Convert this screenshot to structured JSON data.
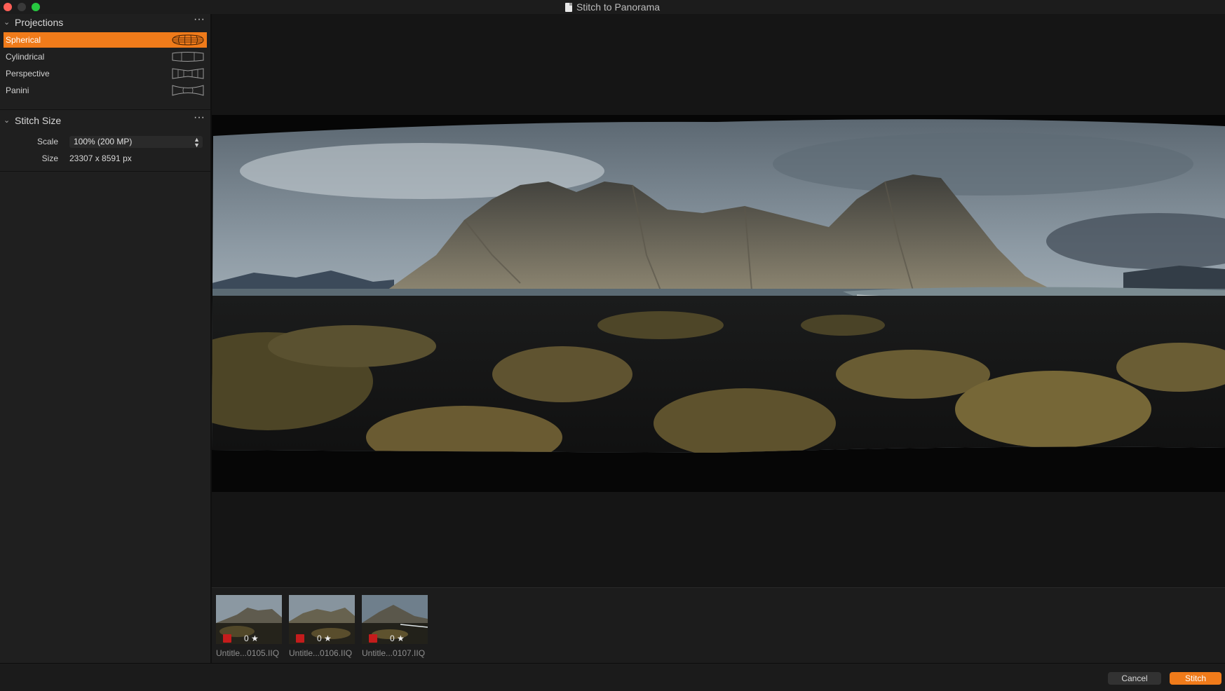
{
  "window": {
    "title": "Stitch to Panorama"
  },
  "projections": {
    "title": "Projections",
    "items": [
      {
        "label": "Spherical",
        "icon": "spherical-projection-icon",
        "selected": true
      },
      {
        "label": "Cylindrical",
        "icon": "cylindrical-projection-icon",
        "selected": false
      },
      {
        "label": "Perspective",
        "icon": "perspective-projection-icon",
        "selected": false
      },
      {
        "label": "Panini",
        "icon": "panini-projection-icon",
        "selected": false
      }
    ]
  },
  "stitch_size": {
    "title": "Stitch Size",
    "scale_label": "Scale",
    "scale_value": "100% (200 MP)",
    "size_label": "Size",
    "size_value": "23307 x 8591 px"
  },
  "filmstrip": {
    "items": [
      {
        "name": "Untitle...0105.IIQ",
        "rating": "0 ★",
        "color_tag": "#c41c1c"
      },
      {
        "name": "Untitle...0106.IIQ",
        "rating": "0 ★",
        "color_tag": "#c41c1c"
      },
      {
        "name": "Untitle...0107.IIQ",
        "rating": "0 ★",
        "color_tag": "#c41c1c"
      }
    ]
  },
  "footer": {
    "cancel_label": "Cancel",
    "stitch_label": "Stitch"
  },
  "colors": {
    "accent": "#f07b1a",
    "close": "#fd5f57",
    "maximize": "#27c840"
  }
}
